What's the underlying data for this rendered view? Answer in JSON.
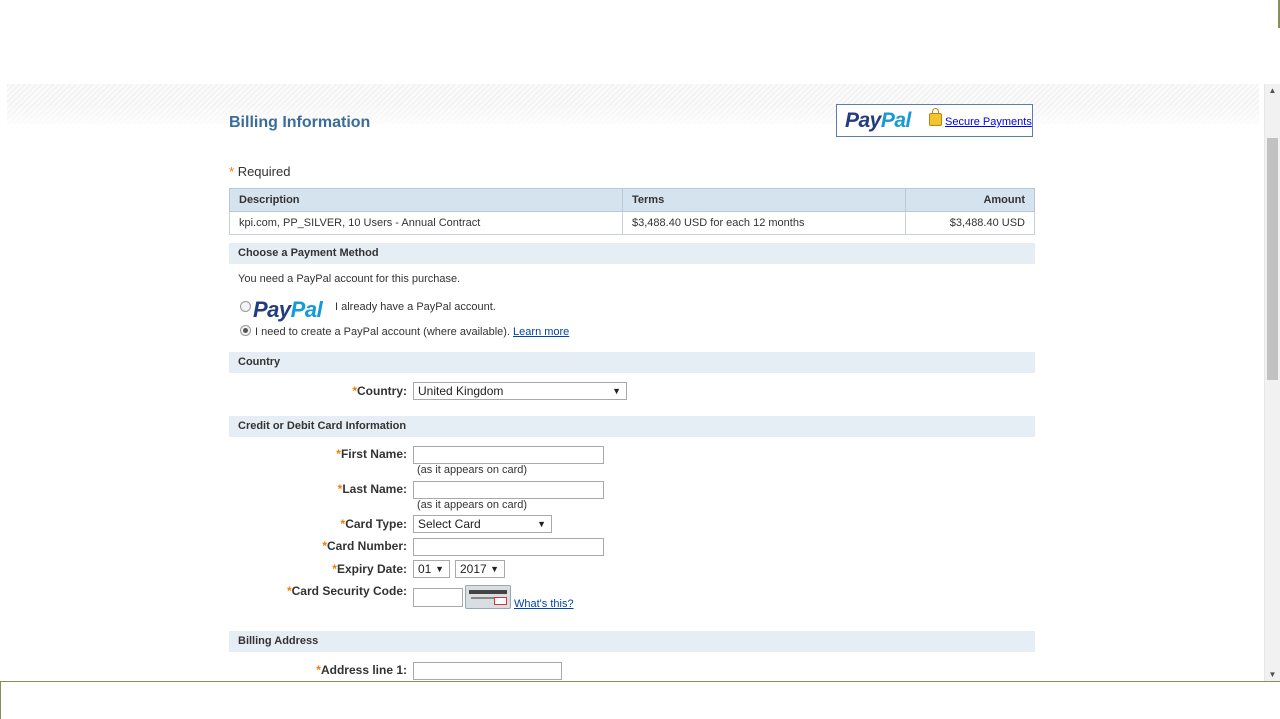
{
  "header": {
    "title": "Billing Information",
    "paypal_logo_part1": "Pay",
    "paypal_logo_part2": "Pal",
    "secure_payments": "Secure Payments",
    "required_note": "Required",
    "required_star": "*"
  },
  "summary": {
    "headers": [
      "Description",
      "Terms",
      "Amount"
    ],
    "row": [
      "kpi.com, PP_SILVER, 10 Users - Annual Contract",
      "$3,488.40 USD for each 12 months",
      "$3,488.40 USD"
    ]
  },
  "payment_method": {
    "header": "Choose a Payment Method",
    "intro": "You need a PayPal account for this purchase.",
    "option1_logo_part1": "Pay",
    "option1_logo_part2": "Pal",
    "option1_label": "I already have a PayPal account.",
    "option2_label": "I need to create a PayPal account (where available).",
    "learn_more": "Learn more",
    "selected": "create"
  },
  "country": {
    "header": "Country",
    "label": "Country:",
    "value": "United Kingdom"
  },
  "card": {
    "header": "Credit or Debit Card Information",
    "first_name_label": "First Name:",
    "first_name_hint": "(as it appears on card)",
    "last_name_label": "Last Name:",
    "last_name_hint": "(as it appears on card)",
    "card_type_label": "Card Type:",
    "card_type_value": "Select Card",
    "card_number_label": "Card Number:",
    "expiry_label": "Expiry Date:",
    "expiry_month": "01",
    "expiry_year": "2017",
    "csc_label": "Card Security Code:",
    "whats_this": "What's this?"
  },
  "billing": {
    "header": "Billing Address",
    "address1_label": "Address line 1:"
  },
  "icons": {
    "dropdown": "▼",
    "scroll_up": "▲",
    "scroll_down": "▼"
  },
  "colors": {
    "title": "#3c6d98",
    "required_star": "#ff7700",
    "section_bg": "#e6eef5",
    "table_header_bg": "#d5e3ef",
    "paypal_dark": "#253b80",
    "paypal_light": "#179bd7"
  }
}
